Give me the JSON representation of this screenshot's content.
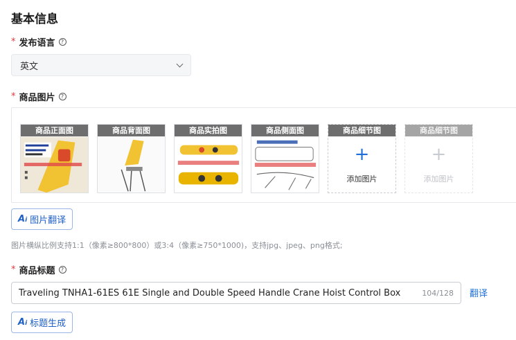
{
  "section_title": "基本信息",
  "language": {
    "label": "发布语言",
    "value": "英文"
  },
  "images": {
    "label": "商品图片",
    "slots": [
      {
        "label": "商品正面图"
      },
      {
        "label": "商品背面图"
      },
      {
        "label": "商品实拍图"
      },
      {
        "label": "商品侧面图"
      },
      {
        "label": "商品细节图",
        "add_text": "添加图片"
      },
      {
        "label": "商品细节图",
        "add_text": "添加图片"
      }
    ],
    "translate_button": "图片翻译",
    "hint": "图片横纵比例支持1:1（像素≥800*800）或3:4（像素≥750*1000)，支持jpg、jpeg、png格式;"
  },
  "product_title": {
    "label": "商品标题",
    "value": "Traveling TNHA1-61ES 61E Single and Double Speed Handle Crane Hoist Control Box",
    "counter": "104/128",
    "translate_link": "翻译",
    "generate_button": "标题生成"
  },
  "colors": {
    "accent": "#1e6fd9",
    "required": "#e4393c"
  }
}
